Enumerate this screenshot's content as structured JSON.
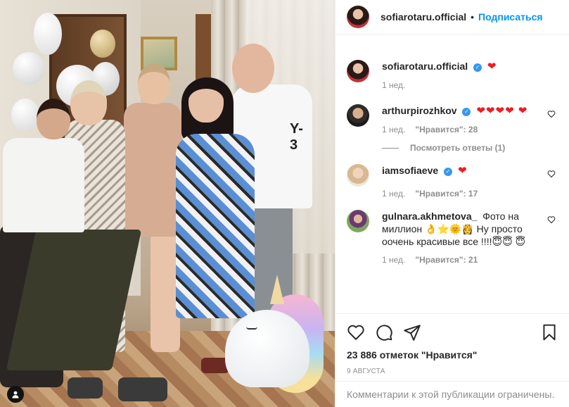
{
  "post": {
    "image_alt": "Group photo"
  },
  "header": {
    "username": "sofiarotaru.official",
    "separator": "•",
    "follow_label": "Подписаться"
  },
  "caption": {
    "username": "sofiarotaru.official",
    "text": "❤",
    "time": "1 нед."
  },
  "comments": [
    {
      "username": "arthurpirozhkov",
      "verified": true,
      "text": "❤❤❤❤ ❤",
      "time": "1 нед.",
      "likes": "\"Нравится\": 28",
      "view_replies": "Посмотреть ответы (1)"
    },
    {
      "username": "iamsofiaeve",
      "verified": true,
      "text": "❤",
      "time": "1 нед.",
      "likes": "\"Нравится\": 17"
    },
    {
      "username": "gulnara.akhmetova_",
      "verified": false,
      "text": "Фото на миллион 👌⭐🌞👸 Ну просто оочень красивые все !!!!😇😇 😇",
      "time": "1 нед.",
      "likes": "\"Нравится\": 21"
    }
  ],
  "actions": {
    "likes_text": "23 886 отметок \"Нравится\"",
    "date": "9 АВГУСТА"
  },
  "footer": {
    "text": "Комментарии к этой публикации ограничены."
  },
  "photo": {
    "tshirt_logo": "Y-3"
  },
  "icons": {
    "verified": "✓"
  },
  "colors": {
    "link_blue": "#0095f6",
    "verified_blue": "#3897f0",
    "heart_red": "#ed1c24",
    "muted_gray": "#8e8e8e"
  }
}
